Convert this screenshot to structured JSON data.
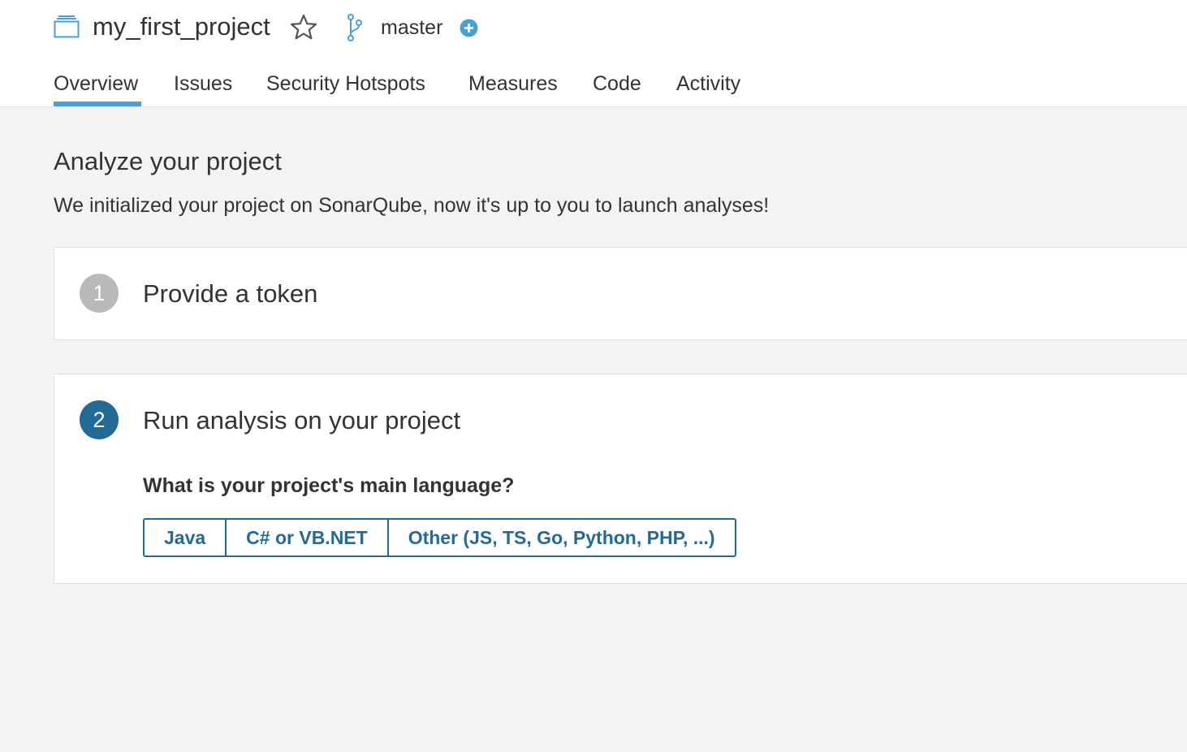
{
  "header": {
    "project_name": "my_first_project",
    "branch_name": "master",
    "project_icon": "project-icon",
    "star_icon": "star-icon",
    "branch_icon": "branch-icon",
    "add_icon": "plus-circle-icon",
    "accent_color": "#4b9fd5"
  },
  "tabs": [
    {
      "label": "Overview",
      "active": true
    },
    {
      "label": "Issues",
      "active": false
    },
    {
      "label": "Security Hotspots",
      "active": false
    },
    {
      "label": "Measures",
      "active": false
    },
    {
      "label": "Code",
      "active": false
    },
    {
      "label": "Activity",
      "active": false
    }
  ],
  "main": {
    "title": "Analyze your project",
    "subtitle": "We initialized your project on SonarQube, now it's up to you to launch analyses!"
  },
  "steps": [
    {
      "number": "1",
      "title": "Provide a token",
      "state": "done"
    },
    {
      "number": "2",
      "title": "Run analysis on your project",
      "state": "current"
    }
  ],
  "language": {
    "question": "What is your project's main language?",
    "options": [
      "Java",
      "C# or VB.NET",
      "Other (JS, TS, Go, Python, PHP, ...)"
    ]
  },
  "colors": {
    "primary": "#236a97",
    "step_done": "#b9b9b9",
    "background": "#f3f3f3"
  }
}
